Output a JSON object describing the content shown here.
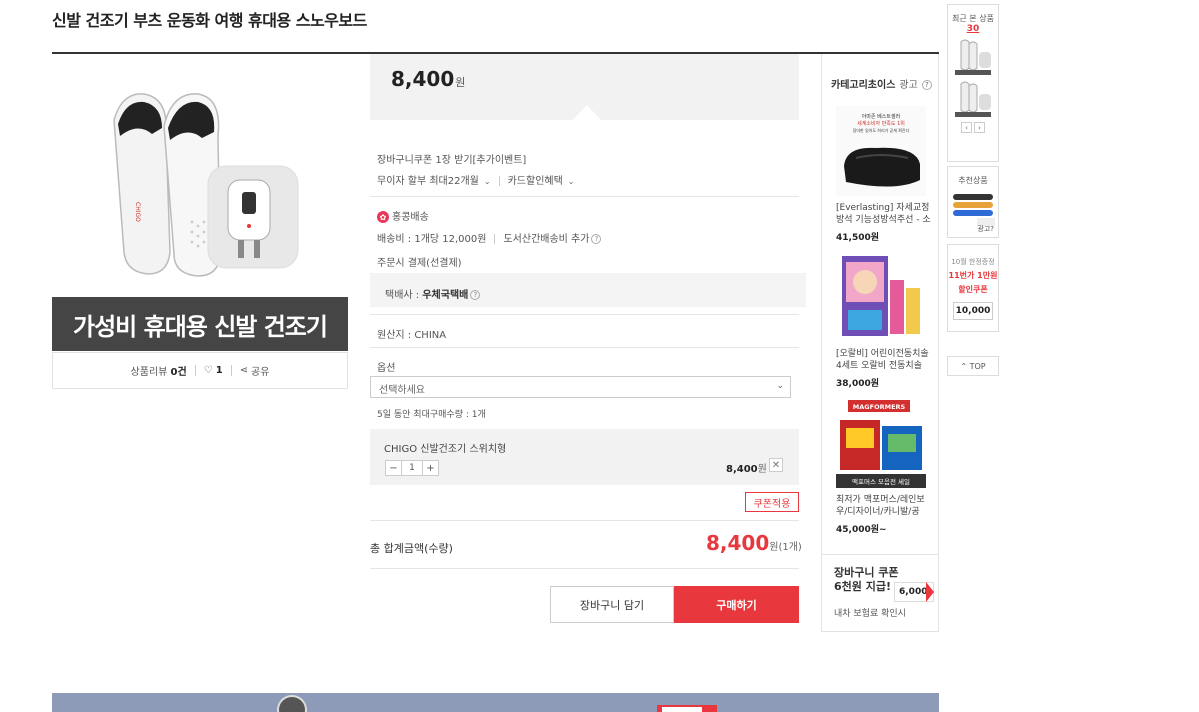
{
  "product": {
    "title": "신발 건조기 부츠 운동화 여행 휴대용 스노우보드",
    "banner_text": "가성비 휴대용 신발 건조기",
    "review_label": "상품리뷰",
    "review_count": "0건",
    "like_count": "1",
    "share_label": "공유"
  },
  "price": {
    "amount": "8,400",
    "unit": "원"
  },
  "benefits": {
    "coupon_text": "장바구니쿠폰 1장 받기[추가이벤트]",
    "installment_text": "무이자 할부 최대22개월",
    "card_discount": "카드할인혜택"
  },
  "shipping": {
    "origin_badge": "홍콩배송",
    "fee_text": "배송비 : 1개당 12,000원",
    "remote_text": "도서산간배송비 추가",
    "payment_text": "주문시 결제(선결제)",
    "carrier_label": "택배사 :",
    "carrier_name": "우체국택배"
  },
  "origin": {
    "text": "원산지 : CHINA"
  },
  "option": {
    "label": "옵션",
    "placeholder": "선택하세요",
    "limit_text": "5일 동안 최대구매수량 : 1개",
    "selected_name": "CHIGO 신발건조기 스위치형",
    "quantity": "1",
    "item_price": "8,400",
    "item_unit": "원",
    "coupon_button": "쿠폰적용"
  },
  "total": {
    "label": "총 합계금액(수량)",
    "amount": "8,400",
    "unit": "원(1개)"
  },
  "actions": {
    "cart": "장바구니 담기",
    "buy": "구매하기"
  },
  "ads": {
    "header": "카테고리초이스",
    "ad_label": "광고",
    "items": [
      {
        "image_caption": "아마존 베스트셀러 세계소비자 만족도 1위 장아한 있어도 허리가 곧게 펴진다",
        "text": "[Everlasting] 자세교정방석 기능성방석주선 - 소",
        "price": "41,500원"
      },
      {
        "image_caption": "",
        "text": "[오랄비] 어린이전동치솔 4세트 오랄비 전동치솔",
        "price": "38,000원"
      },
      {
        "image_caption": "맥포머스 모음전 세일",
        "brand": "MAGFORMERS",
        "text": "최저가 맥포머스/레인보우/디자이너/카니발/공",
        "price": "45,000원~"
      }
    ],
    "cart_coupon_line1": "장바구니 쿠폰",
    "cart_coupon_line2": "6천원 지급!",
    "cart_coupon_amount": "6,000",
    "cart_coupon_sub": "내차 보험료 확인시"
  },
  "sidebar": {
    "recent_label": "최근 본 상품",
    "recent_count": "30",
    "recommend_label": "추천상품",
    "recommend_ad": "광고?",
    "promo_small": "10월 한정증정",
    "promo_big1": "11번가 1만원",
    "promo_big2": "할인쿠폰",
    "promo_amount": "10,000",
    "top_label": "TOP"
  },
  "colors": {
    "accent": "#e8383d",
    "dark": "#454545"
  }
}
